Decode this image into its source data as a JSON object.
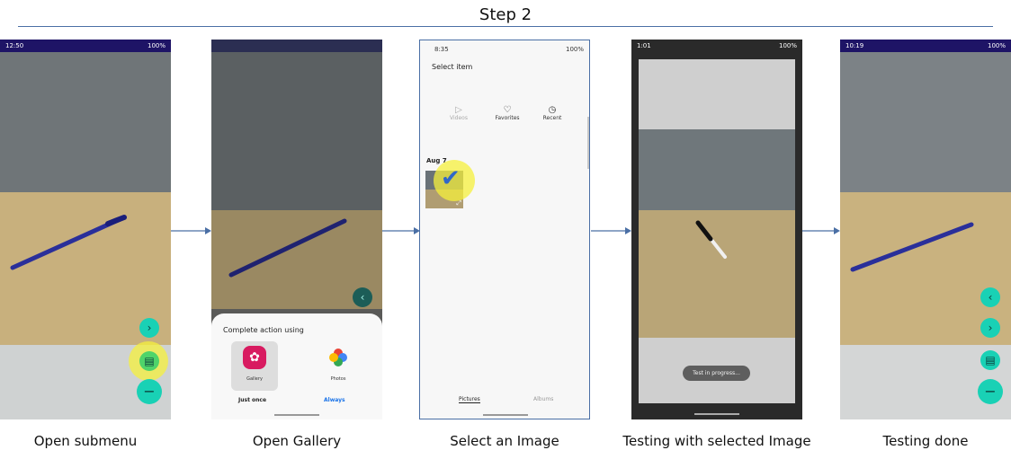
{
  "title": "Step 2",
  "captions": [
    "Open submenu",
    "Open Gallery",
    "Select an Image",
    "Testing with selected Image",
    "Testing done"
  ],
  "status": {
    "p1_time": "12:50",
    "p3_time": "8:35",
    "p4_time": "1:01",
    "p5_time": "10:19",
    "battery": "100%"
  },
  "sheet": {
    "title": "Complete action using",
    "apps": [
      "Gallery",
      "Photos"
    ],
    "just_once": "Just once",
    "always": "Always"
  },
  "picker": {
    "title": "Select item",
    "tabs": [
      "Videos",
      "Favorites",
      "Recent"
    ],
    "date": "Aug 7",
    "bottom_tabs": [
      "Pictures",
      "Albums"
    ]
  },
  "toast": "Test in progress...",
  "colors": {
    "status_bar": "#1e1466",
    "fab": "#19d1b5",
    "highlight": "#f5f03c",
    "arrow": "#4a6fa5"
  }
}
